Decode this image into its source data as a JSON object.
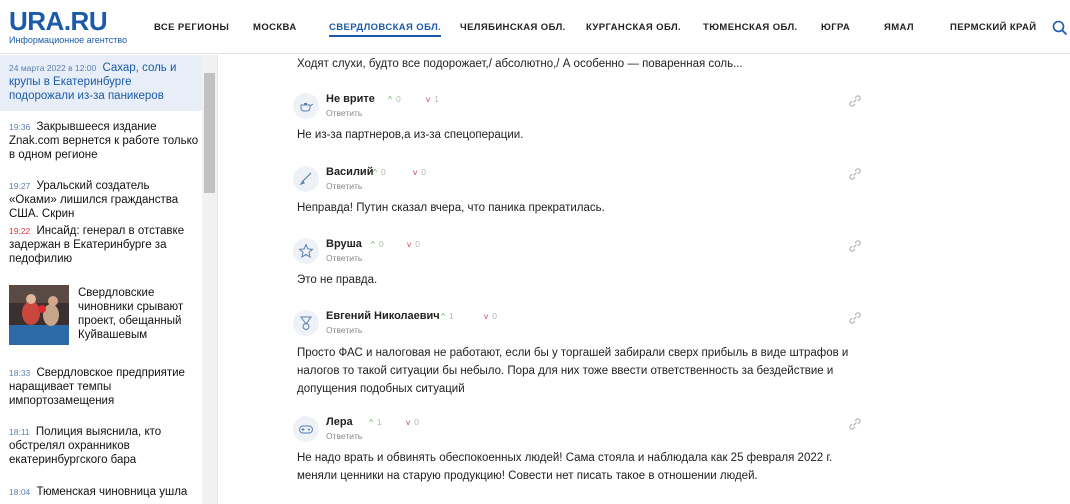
{
  "header": {
    "logo": "URA.RU",
    "logo_sub": "Информационное агентство",
    "nav": [
      "ВСЕ РЕГИОНЫ",
      "МОСКВА",
      "СВЕРДЛОВСКАЯ ОБЛ.",
      "ЧЕЛЯБИНСКАЯ ОБЛ.",
      "КУРГАНСКАЯ ОБЛ.",
      "ТЮМЕНСКАЯ ОБЛ.",
      "ЮГРА",
      "ЯМАЛ",
      "ПЕРМСКИЙ КРАЙ"
    ],
    "active_nav": "СВЕРДЛОВСКАЯ ОБЛ."
  },
  "feed": {
    "active": {
      "date": "24 марта 2022 в 12:00",
      "title": "Сахар, соль и крупы в Екатеринбурге подорожали из-за паникеров"
    },
    "items": [
      {
        "time": "19:36",
        "title": "Закрывшееся издание Znak.com вернется к работе только в одном регионе"
      },
      {
        "time": "19:27",
        "title": "Уральский создатель «Оками» лишился гражданства США. Скрин"
      },
      {
        "time": "19:22",
        "title": "Инсайд: генерал в отставке задержан в Екатеринбурге за педофилию"
      },
      {
        "time": "",
        "title": "Свердловские чиновники срывают проект, обещанный Куйвашевым"
      },
      {
        "time": "18:33",
        "title": "Свердловское предприятие наращивает темпы импортозамещения"
      },
      {
        "time": "18:11",
        "title": "Полиция выяснила, кто обстрелял охранников екатеринбургского бара"
      },
      {
        "time": "18:04",
        "title": "Тюменская чиновница ушла"
      }
    ]
  },
  "quote": "Ходят слухи, будто все подорожает,/ абсолютно,/ А особенно — поваренная соль...",
  "comments": [
    {
      "author": "Не врите",
      "reply": "Ответить",
      "up": "0",
      "down": "1",
      "icon": "teapot-icon",
      "text": "Не из-за партнеров,а из-за спецоперации."
    },
    {
      "author": "Василий",
      "reply": "Ответить",
      "up": "0",
      "down": "0",
      "icon": "brush-icon",
      "text": "Неправда! Путин сказал вчера, что паника прекратилась."
    },
    {
      "author": "Вруша",
      "reply": "Ответить",
      "up": "0",
      "down": "0",
      "icon": "star-icon",
      "text": "Это не правда."
    },
    {
      "author": "Евгений Николаевич",
      "reply": "Ответить",
      "up": "1",
      "down": "0",
      "icon": "medal-icon",
      "text": "Просто ФАС и налоговая не работают, если бы у торгашей забирали сверх прибыль в виде штрафов и налогов то такой ситуации бы небыло. Пора для них тоже ввести ответственность за бездействие и допущения подобных ситуаций"
    },
    {
      "author": "Лера",
      "reply": "Ответить",
      "up": "1",
      "down": "0",
      "icon": "gamepad-icon",
      "text": "Не надо врать и обвинять обеспокоенных людей! Сама стояла и наблюдала как 25 февраля 2022 г. меняли ценники на старую продукцию! Совести нет писать такое в отношении людей."
    }
  ],
  "colors": {
    "brand": "#1b5aa8",
    "up": "#5ab35a",
    "down": "#d44a5a",
    "active_bg": "#e7eef8"
  }
}
